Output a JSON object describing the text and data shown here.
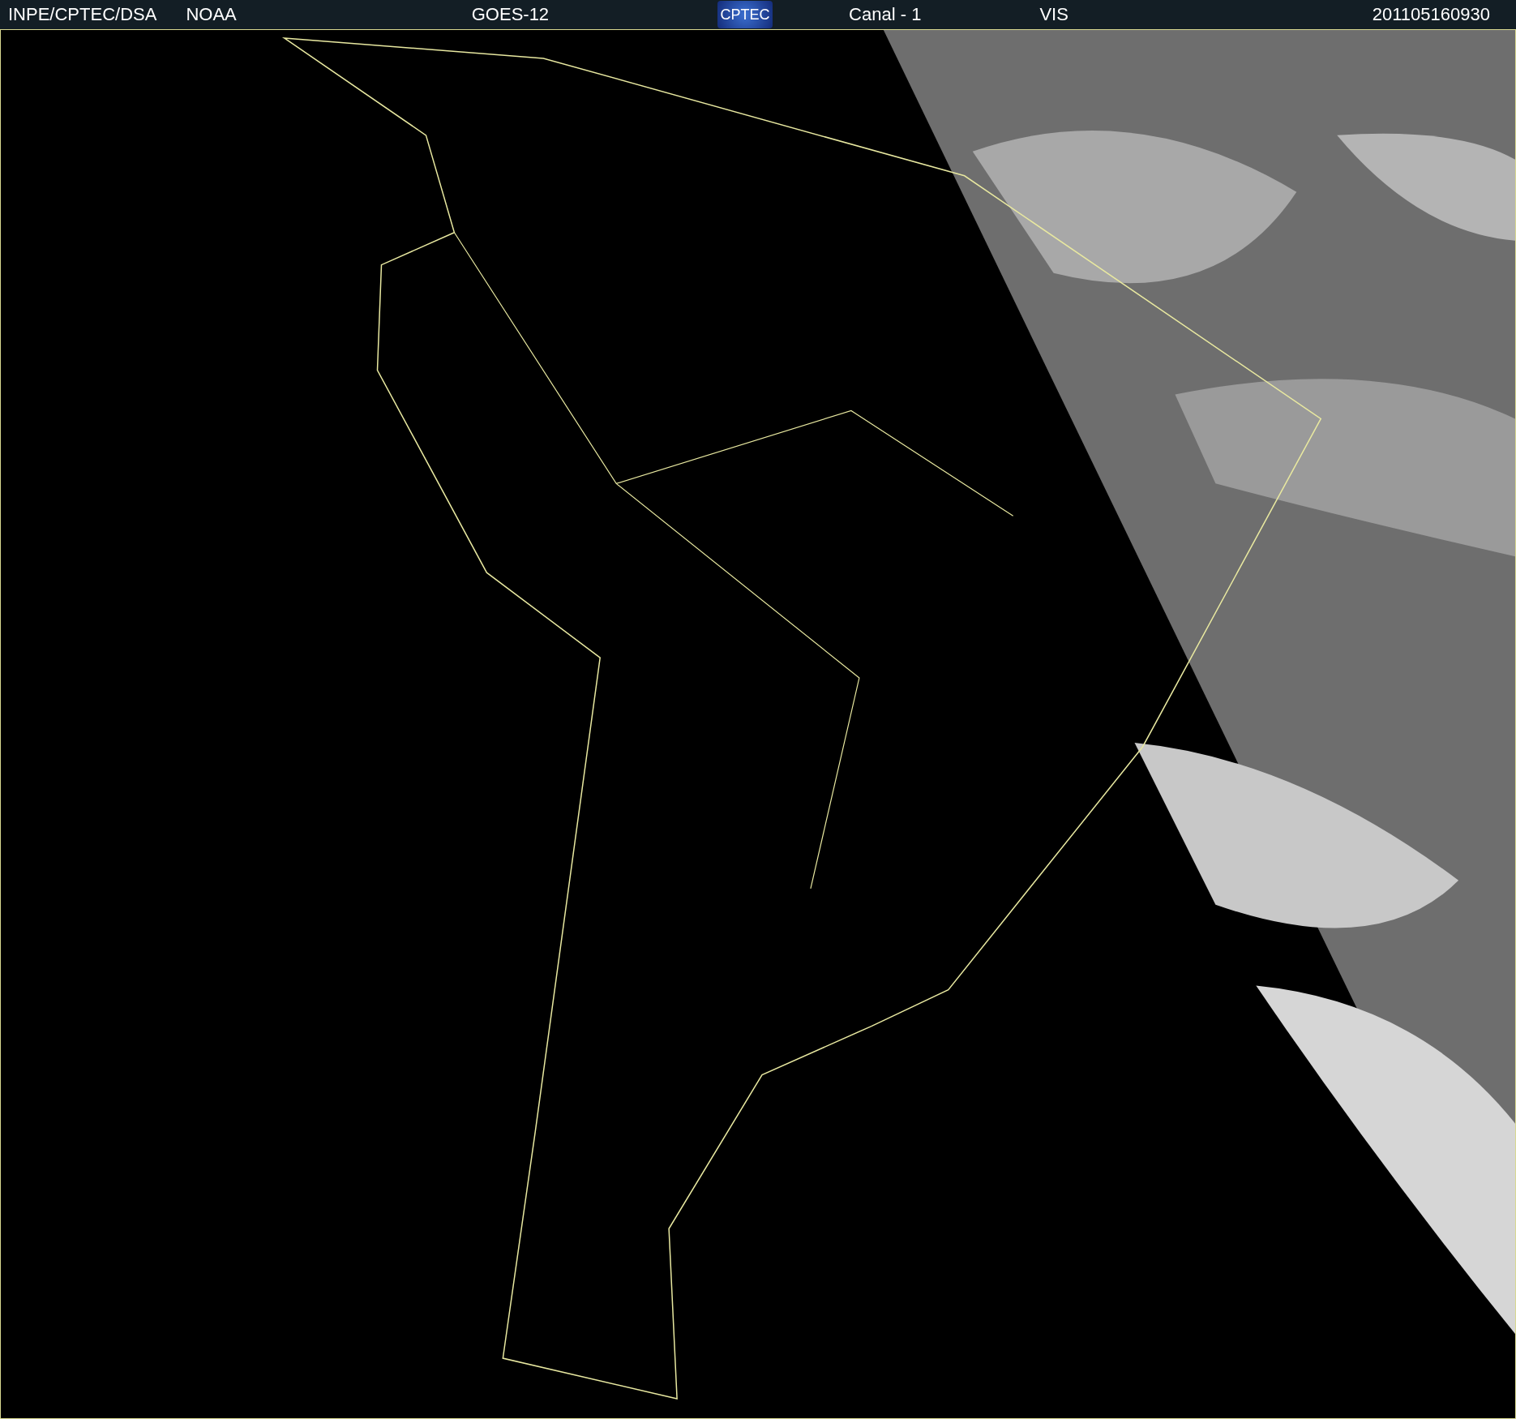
{
  "header": {
    "source": "INPE/CPTEC/DSA",
    "agency": "NOAA",
    "satellite": "GOES-12",
    "logo": "CPTEC",
    "channel": "Canal - 1",
    "band": "VIS",
    "timestamp": "201105160930"
  }
}
